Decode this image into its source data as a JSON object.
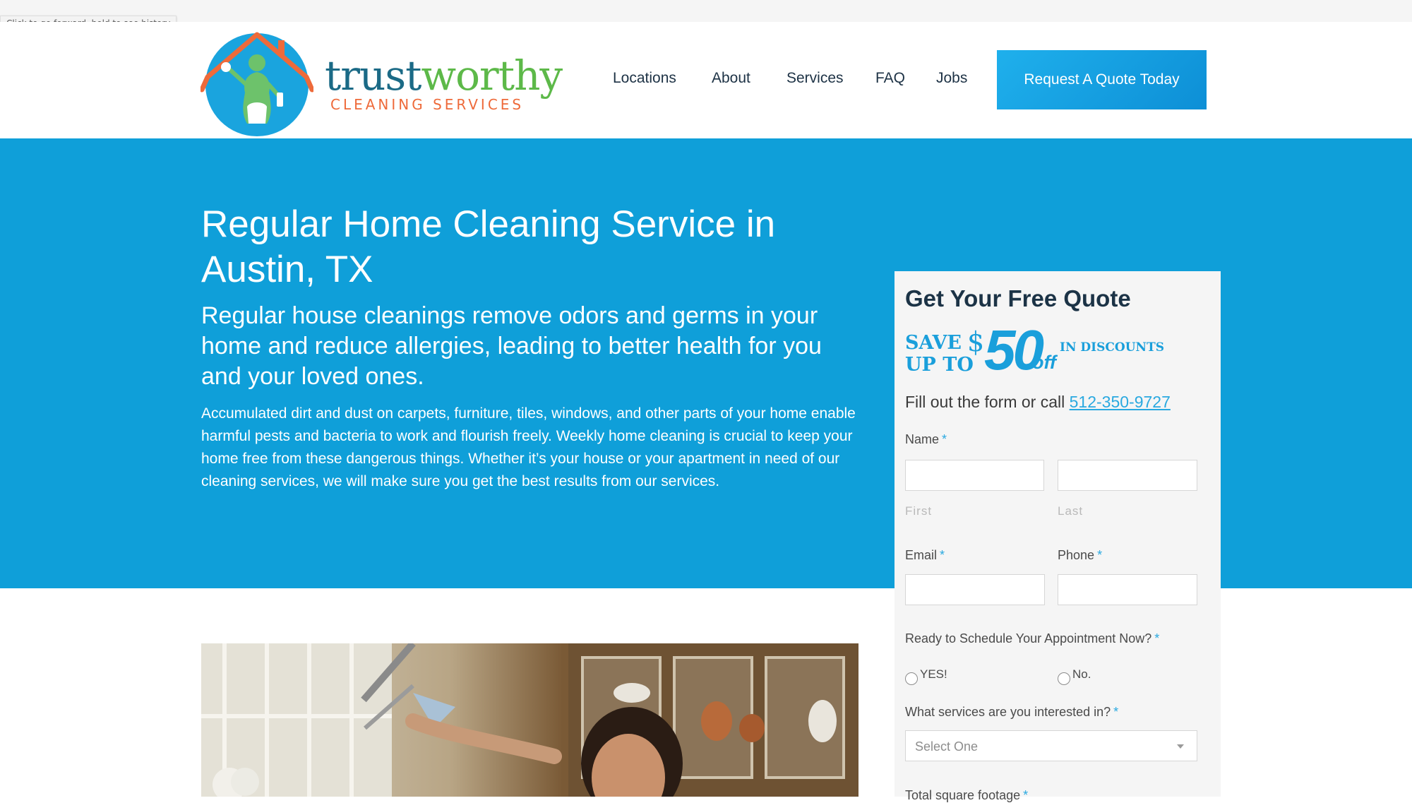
{
  "browser": {
    "tooltip": "Click to go forward, hold to see history"
  },
  "header": {
    "logo": {
      "word_main_a": "trust",
      "word_main_b": "worthy",
      "word_sub": "CLEANING SERVICES",
      "icon": "house-maid-logo"
    },
    "nav": [
      {
        "label": "Locations"
      },
      {
        "label": "About"
      },
      {
        "label": "Services"
      },
      {
        "label": "FAQ"
      },
      {
        "label": "Jobs"
      }
    ],
    "cta_label": "Request A Quote Today"
  },
  "hero": {
    "title": "Regular Home Cleaning Service in Austin, TX",
    "lead": "Regular house cleanings remove odors and germs in your home and reduce allergies, leading to better health for you and your loved ones.",
    "body": "Accumulated dirt and dust on carpets, furniture, tiles, windows, and other parts of your home enable harmful pests and bacteria to work and flourish freely. Weekly home cleaning is crucial to keep your home free from these dangerous things. Whether it’s your house or your apartment in need of our cleaning services, we will make sure you get the best results from our services."
  },
  "quote_form": {
    "title": "Get Your Free Quote",
    "promo": {
      "save_line1": "SAVE",
      "save_line2": "UP TO",
      "dollar": "$",
      "amount": "50",
      "off": "off",
      "in_discounts": "IN DISCOUNTS"
    },
    "call_prefix": "Fill out the form or call ",
    "phone_link": "512-350-9727",
    "required_mark": "*",
    "name_label": "Name",
    "first_label": "First",
    "last_label": "Last",
    "email_label": "Email",
    "phone_label": "Phone",
    "schedule_question": "Ready to Schedule Your Appointment Now?",
    "schedule_yes": "YES!",
    "schedule_no": "No.",
    "services_question": "What services are you interested in?",
    "services_selected": "Select One",
    "footage_label": "Total square footage"
  },
  "colors": {
    "brand_blue": "#0f9fd9",
    "cta_blue": "#1fb0ec",
    "logo_teal": "#1b6a86",
    "logo_green": "#5db949",
    "logo_orange": "#ee6a3a"
  }
}
